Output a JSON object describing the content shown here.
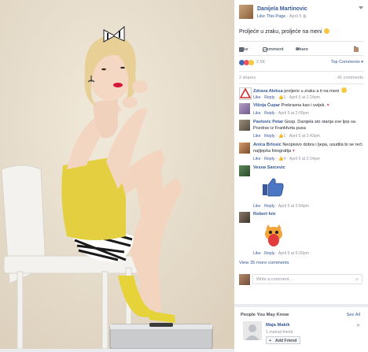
{
  "post": {
    "author": "Danijela Martinovic",
    "like_page": "Like This Page",
    "date": "April 5",
    "text": "Proljeće u zraku, proljeće na meni",
    "actions": {
      "like": "Like",
      "comment": "Comment",
      "share": "Share"
    },
    "reaction_count": "2.5K",
    "top_comments": "Top Comments",
    "shares": "2 shares",
    "comment_count": "41 comments"
  },
  "comments": [
    {
      "author": "Zdrava Aleksa",
      "text": "proljeće u zraku a ti na meni",
      "likes": "1",
      "date": "April 5 at 2:24pm"
    },
    {
      "author": "Višnja Čupar",
      "text": "Prekrasna kao i uvijek.",
      "likes": "",
      "date": "April 5 at 2:08pm"
    },
    {
      "author": "Pavlovic Petar",
      "text": "Gosp. Danijela sto starija sve ljep sa    Pozdrav iz Frankfurta pusa",
      "likes": "1",
      "date": "April 5 at 2:43pm"
    },
    {
      "author": "Anica Brlosic",
      "text": "Neopisivo dobra i ljepa, usudila bi se reći najljepša fotografija",
      "likes": "4",
      "date": "April 5 at 2:14pm"
    },
    {
      "author": "Vesna Sarcevic",
      "text": "",
      "likes": "",
      "date": "April 5 at 2:04pm"
    },
    {
      "author": "Robert Ivic",
      "text": "",
      "likes": "",
      "date": "April 5 at 9:30pm"
    }
  ],
  "comment_labels": {
    "like": "Like",
    "reply": "Reply"
  },
  "view_more": "View 35 more comments",
  "write_placeholder": "Write a comment...",
  "pymk": {
    "title": "People You May Know",
    "see_all": "See All",
    "name": "Maja Makik",
    "mutual": "1 mutual friend",
    "add_button": "Add Friend"
  },
  "colors": {
    "link": "#365899",
    "muted": "#90949c",
    "dress": "#e3cf3f"
  }
}
